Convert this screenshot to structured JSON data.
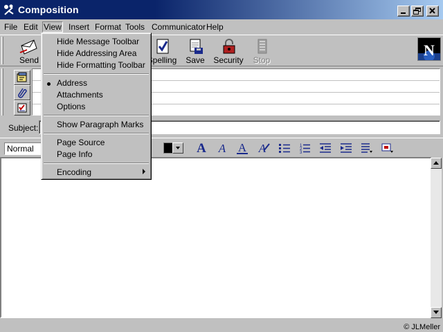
{
  "window": {
    "title": "Composition"
  },
  "menubar": {
    "file": "File",
    "edit": "Edit",
    "view": "View",
    "insert": "Insert",
    "format": "Format",
    "tools": "Tools",
    "communicator": "Communicator",
    "help": "Help"
  },
  "toolbar": {
    "send": "Send",
    "spelling": "Spelling",
    "save": "Save",
    "security": "Security",
    "stop": "Stop"
  },
  "branding": {
    "logo_letter": "N"
  },
  "subject": {
    "label": "Subject:",
    "value": ""
  },
  "format_bar": {
    "style_value": "Normal"
  },
  "view_menu": {
    "hide_message_toolbar": "Hide Message Toolbar",
    "hide_addressing_area": "Hide Addressing Area",
    "hide_formatting_toolbar": "Hide Formatting Toolbar",
    "address": "Address",
    "attachments": "Attachments",
    "options": "Options",
    "show_paragraph_marks": "Show Paragraph Marks",
    "page_source": "Page Source",
    "page_info": "Page Info",
    "encoding": "Encoding",
    "checked_item": "Address"
  },
  "status": {
    "copyright": "© JLMeller"
  },
  "colors": {
    "titlebar_start": "#0a246a",
    "titlebar_end": "#a6caf0",
    "face": "#c0c0c0",
    "format_icon": "#1a2a8c"
  },
  "icons": {
    "titlebar": "netscape-quill-icon",
    "send": "send-envelope-icon",
    "spelling": "spelling-check-icon",
    "save": "save-disk-icon",
    "security": "security-padlock-icon",
    "stop": "stop-icon",
    "address_tab": "address-card-icon",
    "attach_tab": "paperclip-icon",
    "options_tab": "options-checklist-icon"
  }
}
